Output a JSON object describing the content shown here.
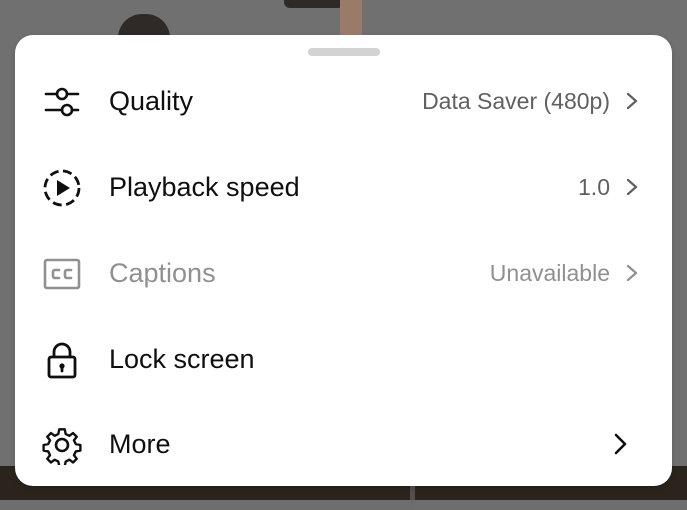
{
  "menu": {
    "items": [
      {
        "label": "Quality",
        "value": "Data Saver (480p)",
        "icon": "sliders-icon",
        "enabled": true
      },
      {
        "label": "Playback speed",
        "value": "1.0",
        "icon": "playback-speed-icon",
        "enabled": true
      },
      {
        "label": "Captions",
        "value": "Unavailable",
        "icon": "closed-captions-icon",
        "enabled": false
      },
      {
        "label": "Lock screen",
        "value": "",
        "icon": "lock-icon",
        "enabled": true
      },
      {
        "label": "More",
        "value": "",
        "icon": "gear-icon",
        "enabled": true
      }
    ]
  },
  "colors": {
    "text_primary": "#0f0f0f",
    "text_secondary": "#606060",
    "text_disabled": "#909090",
    "sheet_background": "#ffffff",
    "handle": "#d3d3d3"
  }
}
